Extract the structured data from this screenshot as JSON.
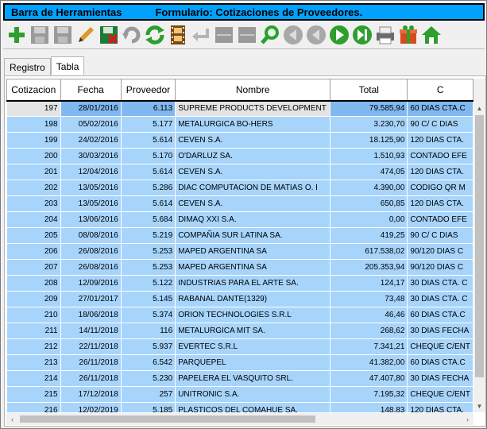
{
  "title": {
    "left": "Barra de Herramientas",
    "right": "Formulario: Cotizaciones de Proveedores."
  },
  "toolbar": [
    {
      "name": "add-icon",
      "color": "#2e9e2e"
    },
    {
      "name": "save-disabled-icon",
      "color": "#9a9a9a"
    },
    {
      "name": "save-as-disabled-icon",
      "color": "#9a9a9a"
    },
    {
      "name": "edit-pencil-icon",
      "color": "#d99a2b"
    },
    {
      "name": "delete-save-icon",
      "color": "#1f7a3a"
    },
    {
      "name": "undo-disabled-icon",
      "color": "#9a9a9a"
    },
    {
      "name": "refresh-icon",
      "color": "#2e9e2e"
    },
    {
      "name": "film-icon",
      "color": "#7a4a12"
    },
    {
      "name": "return-disabled-icon",
      "color": "#b5b5b5"
    },
    {
      "name": "disabled-panel-1-icon",
      "color": "#9a9a9a"
    },
    {
      "name": "disabled-panel-2-icon",
      "color": "#9a9a9a"
    },
    {
      "name": "search-icon",
      "color": "#2e9e2e"
    },
    {
      "name": "first-disabled-icon",
      "color": "#a8a8a8"
    },
    {
      "name": "prev-disabled-icon",
      "color": "#a8a8a8"
    },
    {
      "name": "next-icon",
      "color": "#2e9e2e"
    },
    {
      "name": "last-icon",
      "color": "#2e9e2e"
    },
    {
      "name": "printer-icon",
      "color": "#6a6a6a"
    },
    {
      "name": "gift-icon",
      "color": "#d64b1e"
    },
    {
      "name": "home-icon",
      "color": "#2e9e2e"
    }
  ],
  "tabs": [
    {
      "label": "Registro",
      "active": false
    },
    {
      "label": "Tabla",
      "active": true
    }
  ],
  "table": {
    "columns": [
      "Cotizacion",
      "Fecha",
      "Proveedor",
      "Nombre",
      "Total",
      "C"
    ],
    "rows": [
      [
        "197",
        "28/01/2016",
        "6.113",
        "SUPREME PRODUCTS DEVELOPMENT",
        "79.585,94",
        "60 DIAS CTA.C"
      ],
      [
        "198",
        "05/02/2016",
        "5.177",
        "METALURGICA BO-HERS",
        "3.230,70",
        "90 C/ C DIAS"
      ],
      [
        "199",
        "24/02/2016",
        "5.614",
        "CEVEN S.A.",
        "18.125,90",
        "120 DIAS CTA."
      ],
      [
        "200",
        "30/03/2016",
        "5.170",
        "O'DARLUZ SA.",
        "1.510,93",
        "CONTADO EFE"
      ],
      [
        "201",
        "12/04/2016",
        "5.614",
        "CEVEN S.A.",
        "474,05",
        "120 DIAS CTA."
      ],
      [
        "202",
        "13/05/2016",
        "5.286",
        "DIAC COMPUTACION DE MATIAS O. I",
        "4.390,00",
        "CODIGO QR M"
      ],
      [
        "203",
        "13/05/2016",
        "5.614",
        "CEVEN S.A.",
        "650,85",
        "120 DIAS CTA."
      ],
      [
        "204",
        "13/06/2016",
        "5.684",
        "DIMAQ XXI S.A.",
        "0,00",
        "CONTADO EFE"
      ],
      [
        "205",
        "08/08/2016",
        "5.219",
        "COMPAÑIA SUR LATINA SA.",
        "419,25",
        "90 C/ C DIAS"
      ],
      [
        "206",
        "26/08/2016",
        "5.253",
        "MAPED ARGENTINA SA",
        "617.538,02",
        "90/120 DIAS C"
      ],
      [
        "207",
        "26/08/2016",
        "5.253",
        "MAPED ARGENTINA SA",
        "205.353,94",
        "90/120 DIAS C"
      ],
      [
        "208",
        "12/09/2016",
        "5.122",
        "INDUSTRIAS PARA EL ARTE SA.",
        "124,17",
        "30 DIAS CTA. C"
      ],
      [
        "209",
        "27/01/2017",
        "5.145",
        "RABANAL DANTE(1329)",
        "73,48",
        "30 DIAS CTA. C"
      ],
      [
        "210",
        "18/06/2018",
        "5.374",
        "ORION TECHNOLOGIES S.R.L",
        "46,46",
        "60 DIAS CTA.C"
      ],
      [
        "211",
        "14/11/2018",
        "116",
        "METALURGICA MIT SA.",
        "268,62",
        "30 DIAS FECHA"
      ],
      [
        "212",
        "22/11/2018",
        "5.937",
        "EVERTEC S.R.L",
        "7.341,21",
        "CHEQUE C/ENT"
      ],
      [
        "213",
        "26/11/2018",
        "6.542",
        "PARQUEPEL",
        "41.382,00",
        "60 DIAS CTA.C"
      ],
      [
        "214",
        "26/11/2018",
        "5.230",
        "PAPELERA EL VASQUITO SRL.",
        "47.407,80",
        "30 DIAS FECHA"
      ],
      [
        "215",
        "17/12/2018",
        "257",
        "UNITRONIC S.A.",
        "7.195,32",
        "CHEQUE C/ENT"
      ],
      [
        "216",
        "12/02/2019",
        "5.185",
        "PLASTICOS DEL COMAHUE SA.",
        "148,83",
        "120 DIAS CTA."
      ]
    ]
  }
}
